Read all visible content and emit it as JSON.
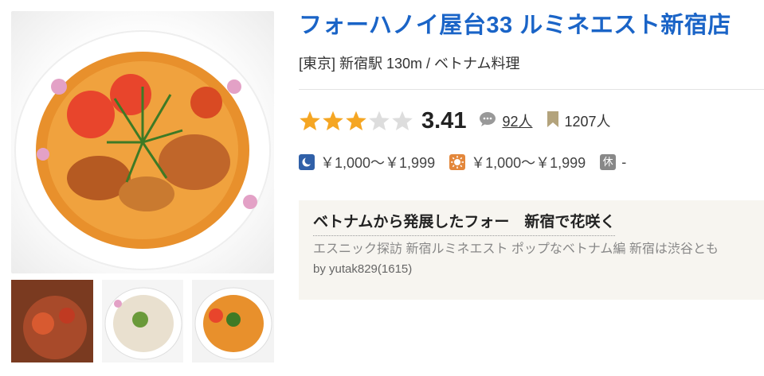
{
  "restaurant": {
    "name": "フォーハノイ屋台33 ルミネエスト新宿店",
    "area": "[東京] 新宿駅 130m / ベトナム料理"
  },
  "rating": {
    "stars": 3,
    "max_stars": 5,
    "score": "3.41",
    "review_count": "92人",
    "save_count": "1207人"
  },
  "price": {
    "dinner": "￥1,000～￥1,999",
    "lunch": "￥1,000～￥1,999",
    "holiday_label": "休",
    "holiday_value": "-"
  },
  "review": {
    "title": "ベトナムから発展したフォー　新宿で花咲く",
    "excerpt": "エスニック探訪 新宿ルミネエスト ポップなベトナム編 新宿は渋谷とも",
    "author": "by yutak829(1615)"
  },
  "colors": {
    "title": "#1a64c7",
    "star_on": "#f5a623",
    "star_off": "#dddddd",
    "dinner_icon": "#3060a8",
    "lunch_icon": "#e3873b"
  },
  "icons": [
    "star-icon",
    "review-bubble-icon",
    "bookmark-icon",
    "moon-icon",
    "sun-icon"
  ]
}
